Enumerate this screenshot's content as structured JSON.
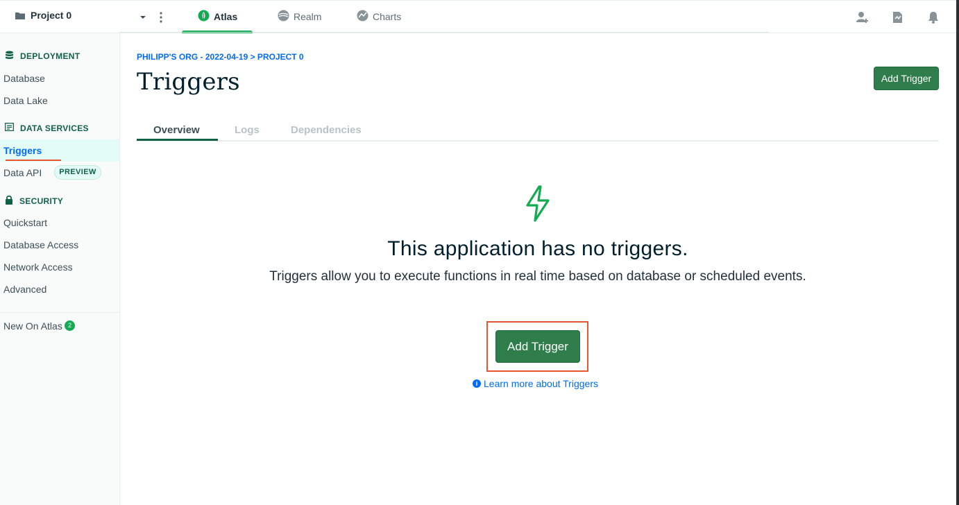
{
  "topbar": {
    "project_name": "Project 0",
    "apps": [
      {
        "label": "Atlas",
        "icon": "atlas-leaf-icon",
        "active": true
      },
      {
        "label": "Realm",
        "icon": "realm-icon",
        "active": false
      },
      {
        "label": "Charts",
        "icon": "charts-icon",
        "active": false
      }
    ],
    "right_icons": [
      "invite-user-icon",
      "activity-feed-icon",
      "notifications-bell-icon"
    ]
  },
  "sidebar": {
    "sections": [
      {
        "title": "DEPLOYMENT",
        "icon": "database-stack-icon"
      },
      {
        "title": "DATA SERVICES",
        "icon": "data-services-icon"
      },
      {
        "title": "SECURITY",
        "icon": "lock-icon"
      }
    ],
    "deployment_items": [
      "Database",
      "Data Lake"
    ],
    "data_services_items": [
      "Triggers",
      "Data API"
    ],
    "data_api_badge": "PREVIEW",
    "security_items": [
      "Quickstart",
      "Database Access",
      "Network Access",
      "Advanced"
    ],
    "new_on_atlas": "New On Atlas",
    "new_on_atlas_count": "2",
    "active_item": "Triggers"
  },
  "main": {
    "breadcrumb": "PHILIPP'S ORG - 2022-04-19 > PROJECT 0",
    "title": "Triggers",
    "add_trigger_label": "Add Trigger",
    "tabs": [
      "Overview",
      "Logs",
      "Dependencies"
    ],
    "active_tab": "Overview",
    "empty_state": {
      "title": "This application has no triggers.",
      "description": "Triggers allow you to execute functions in real time based on database or scheduled events.",
      "button_label": "Add Trigger",
      "learn_more": "Learn more about Triggers",
      "icon": "lightning-bolt-icon"
    }
  },
  "colors": {
    "accent_green": "#13aa52",
    "button_green": "#2e7d4a",
    "link_blue": "#016bf8",
    "highlight_red": "#e8542b",
    "sidebar_active_bg": "#e3fcf7"
  }
}
